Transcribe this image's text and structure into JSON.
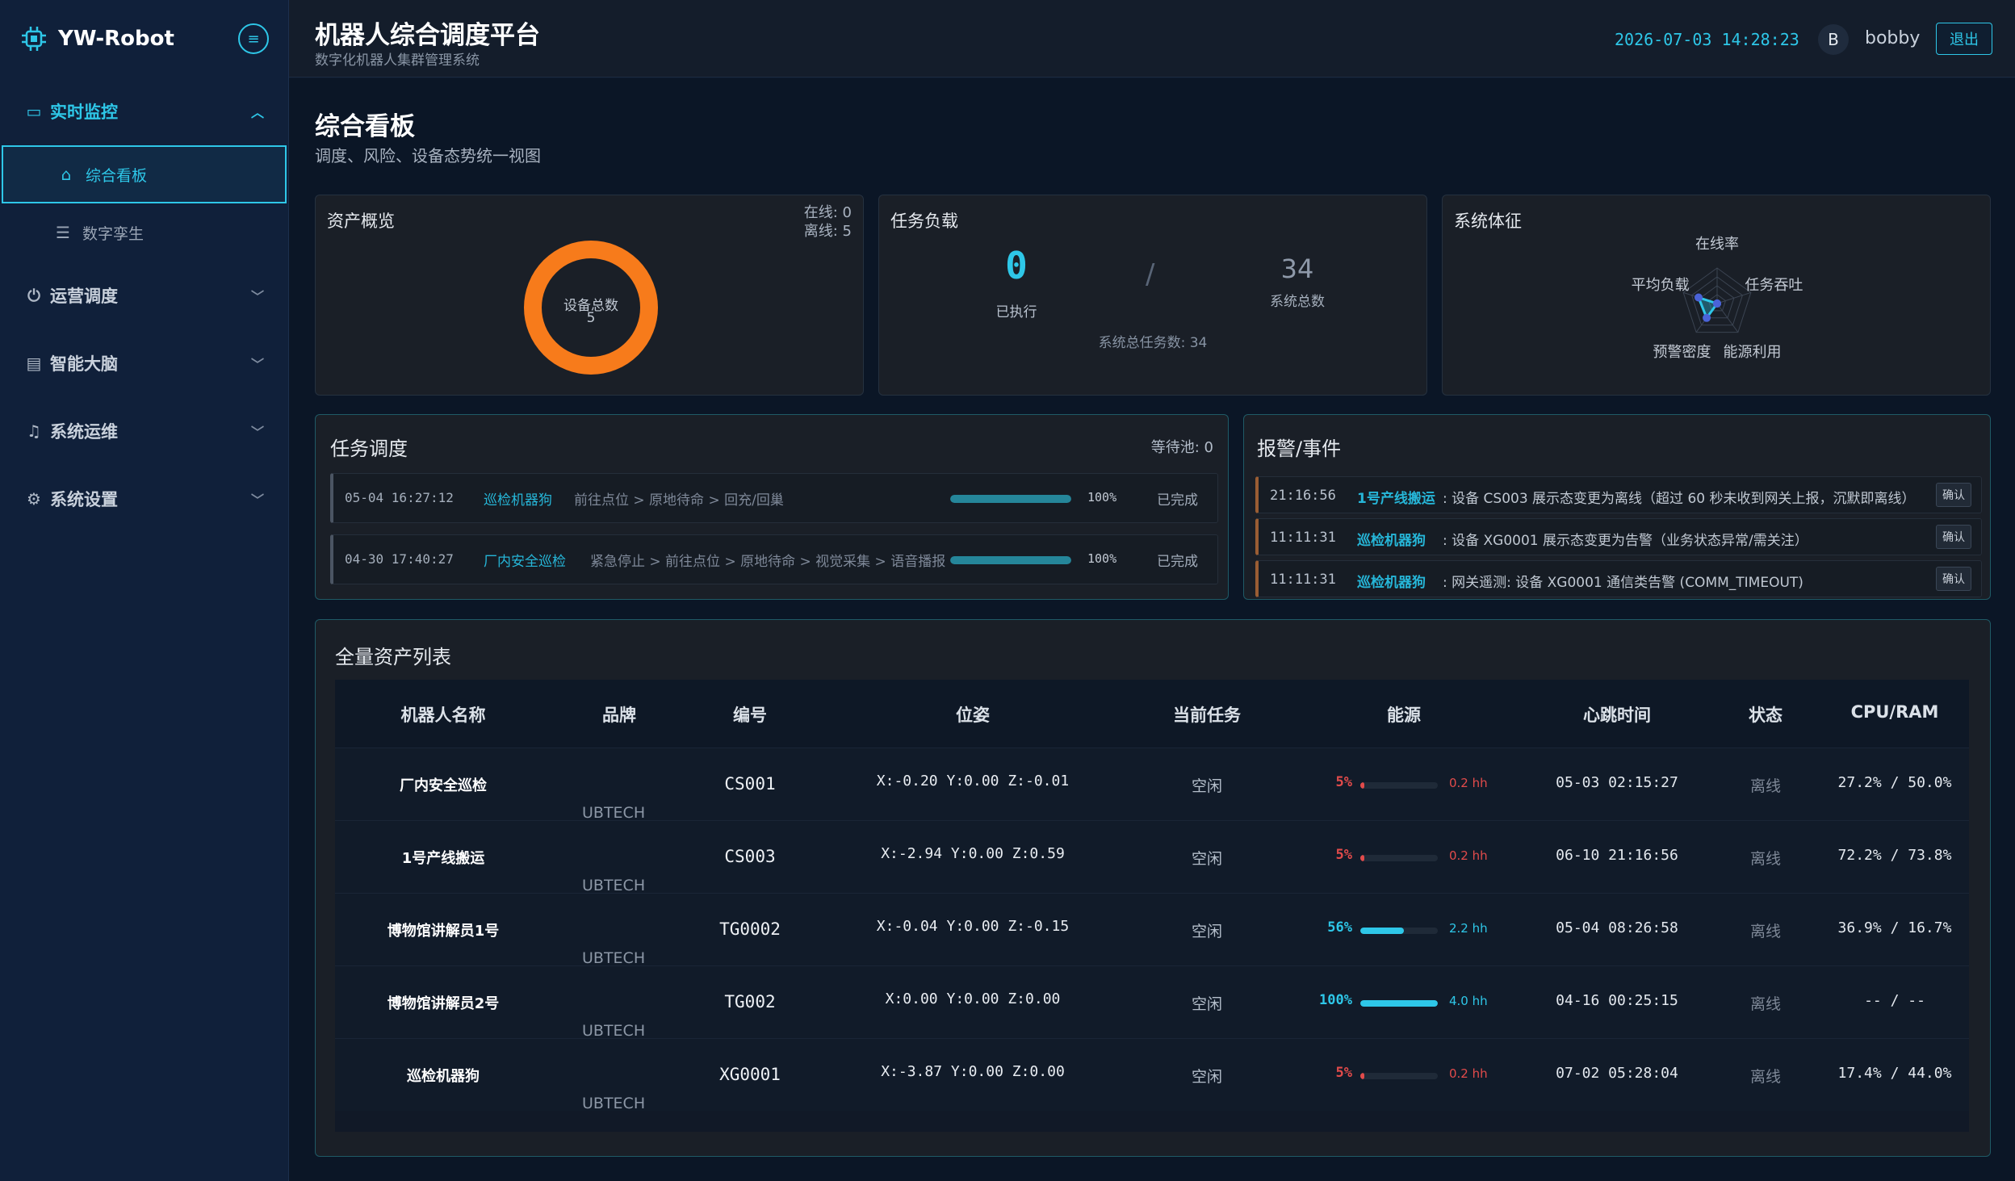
{
  "brand": {
    "name": "YW-Robot"
  },
  "sidebar": {
    "groups": [
      {
        "label": "实时监控",
        "active": true,
        "items": [
          {
            "label": "综合看板",
            "active": true
          },
          {
            "label": "数字孪生",
            "active": false
          }
        ]
      },
      {
        "label": "运营调度"
      },
      {
        "label": "智能大脑"
      },
      {
        "label": "系统运维"
      },
      {
        "label": "系统设置"
      }
    ]
  },
  "header": {
    "title": "机器人综合调度平台",
    "subtitle": "数字化机器人集群管理系统",
    "datetime": "2026-07-03 14:28:23",
    "avatar_initial": "B",
    "username": "bobby",
    "logout_label": "退出"
  },
  "page": {
    "title": "综合看板",
    "description": "调度、风险、设备态势统一视图"
  },
  "asset_overview": {
    "title": "资产概览",
    "online": "在线: 0",
    "offline": "离线: 5",
    "donut_label": "设备总数",
    "donut_value": "5",
    "online_count": 0,
    "total": 5
  },
  "task_load": {
    "title": "任务负载",
    "executed": "0",
    "executed_label": "已执行",
    "separator": "/",
    "total": "34",
    "total_label": "系统总数",
    "summary": "系统总任务数: 34"
  },
  "vitals": {
    "title": "系统体征",
    "axes": [
      "在线率",
      "任务吞吐",
      "能源利用",
      "预警密度",
      "平均负载"
    ],
    "values": [
      0,
      0,
      0,
      0.5,
      0.55
    ],
    "color": "#2ec7e8"
  },
  "dispatch": {
    "title": "任务调度",
    "pool": "等待池: 0",
    "rows": [
      {
        "time": "05-04 16:27:12",
        "robot": "巡检机器狗",
        "path": "前往点位 > 原地待命 > 回充/回巢",
        "progress": 100,
        "pct": "100%",
        "state": "已完成"
      },
      {
        "time": "04-30 17:40:27",
        "robot": "厂内安全巡检",
        "path": "紧急停止 > 前往点位 > 原地待命 > 视觉采集 > 语音播报",
        "progress": 100,
        "pct": "100%",
        "state": "已完成"
      }
    ]
  },
  "alerts": {
    "title": "报警/事件",
    "rows": [
      {
        "time": "21:16:56",
        "source": "1号产线搬运",
        "message": ": 设备 CS003 展示态变更为离线（超过 60 秒未收到网关上报，沉默即离线）",
        "action": "确认"
      },
      {
        "time": "11:11:31",
        "source": "巡检机器狗",
        "message": ": 设备 XG0001 展示态变更为告警（业务状态异常/需关注）",
        "action": "确认"
      },
      {
        "time": "11:11:31",
        "source": "巡检机器狗",
        "message": ": 网关遥测: 设备 XG0001 通信类告警 (COMM_TIMEOUT)",
        "action": "确认"
      }
    ]
  },
  "assets": {
    "title": "全量资产列表",
    "columns": [
      "机器人名称",
      "品牌",
      "编号",
      "位姿",
      "当前任务",
      "能源",
      "心跳时间",
      "状态",
      "CPU/RAM"
    ],
    "rows": [
      {
        "name": "厂内安全巡检",
        "brand": "UBTECH",
        "code": "CS001",
        "pose": "X:-0.20 Y:0.00 Z:-0.01",
        "task": "空闲",
        "energy_pct": "5%",
        "energy": 5,
        "hours": "0.2 hh",
        "heartbeat": "05-03 02:15:27",
        "status": "离线",
        "cpu_ram": "27.2% / 50.0%"
      },
      {
        "name": "1号产线搬运",
        "brand": "UBTECH",
        "code": "CS003",
        "pose": "X:-2.94 Y:0.00 Z:0.59",
        "task": "空闲",
        "energy_pct": "5%",
        "energy": 5,
        "hours": "0.2 hh",
        "heartbeat": "06-10 21:16:56",
        "status": "离线",
        "cpu_ram": "72.2% / 73.8%"
      },
      {
        "name": "博物馆讲解员1号",
        "brand": "UBTECH",
        "code": "TG0002",
        "pose": "X:-0.04 Y:0.00 Z:-0.15",
        "task": "空闲",
        "energy_pct": "56%",
        "energy": 56,
        "hours": "2.2 hh",
        "heartbeat": "05-04 08:26:58",
        "status": "离线",
        "cpu_ram": "36.9% / 16.7%"
      },
      {
        "name": "博物馆讲解员2号",
        "brand": "UBTECH",
        "code": "TG002",
        "pose": "X:0.00 Y:0.00 Z:0.00",
        "task": "空闲",
        "energy_pct": "100%",
        "energy": 100,
        "hours": "4.0 hh",
        "heartbeat": "04-16 00:25:15",
        "status": "离线",
        "cpu_ram": "-- / --"
      },
      {
        "name": "巡检机器狗",
        "brand": "UBTECH",
        "code": "XG0001",
        "pose": "X:-3.87 Y:0.00 Z:0.00",
        "task": "空闲",
        "energy_pct": "5%",
        "energy": 5,
        "hours": "0.2 hh",
        "heartbeat": "07-02 05:28:04",
        "status": "离线",
        "cpu_ram": "17.4% / 44.0%"
      }
    ]
  },
  "colors": {
    "accent": "#2ec7e8",
    "donut": "#f77b1b",
    "energy_low": "#e24b4b",
    "energy_ok": "#2ec7e8"
  }
}
